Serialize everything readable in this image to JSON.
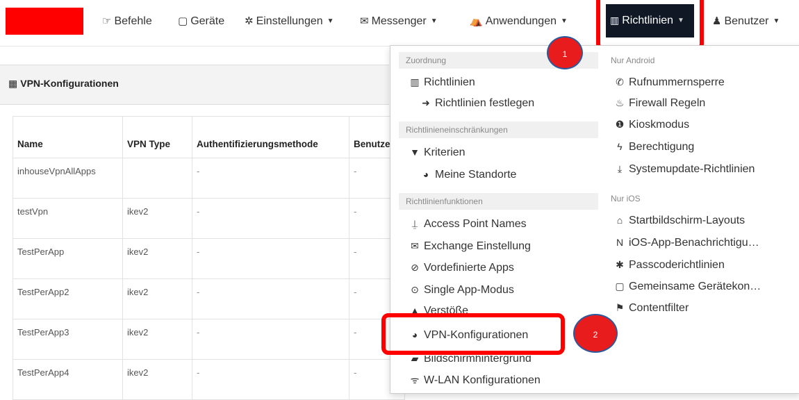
{
  "nav": {
    "items": [
      {
        "id": "befehle",
        "label": "Befehle",
        "icon": "hand-point-icon",
        "glyph": "☞",
        "caret": false
      },
      {
        "id": "geraete",
        "label": "Geräte",
        "icon": "mobile-icon",
        "glyph": "▢",
        "caret": false
      },
      {
        "id": "einstellungen",
        "label": "Einstellungen",
        "icon": "gear-icon",
        "glyph": "✲",
        "caret": true
      },
      {
        "id": "messenger",
        "label": "Messenger",
        "icon": "envelope-icon",
        "glyph": "✉",
        "caret": true
      },
      {
        "id": "anwendungen",
        "label": "Anwendungen",
        "icon": "app-stamp-icon",
        "glyph": "⛺",
        "caret": true
      }
    ],
    "active": {
      "label": "Richtlinien",
      "icon": "columns-icon",
      "glyph": "▥"
    },
    "user": {
      "label": "Benutzer",
      "icon": "user-icon",
      "glyph": "♟"
    }
  },
  "panel": {
    "title": "VPN-Konfigurationen",
    "icon": "th-grid-icon",
    "glyph": "▦"
  },
  "table": {
    "columns": [
      "Name",
      "VPN Type",
      "Authentifizierungsmethode",
      "Benutze"
    ],
    "rows": [
      [
        "inhouseVpnAllApps",
        "",
        "-",
        "-"
      ],
      [
        "testVpn",
        "ikev2",
        "-",
        "-"
      ],
      [
        "TestPerApp",
        "ikev2",
        "-",
        "-"
      ],
      [
        "TestPerApp2",
        "ikev2",
        "-",
        "-"
      ],
      [
        "TestPerApp3",
        "ikev2",
        "-",
        "-"
      ],
      [
        "TestPerApp4",
        "ikev2",
        "-",
        "-"
      ]
    ]
  },
  "menu": {
    "left": {
      "zuordnung_header": "Zuordnung",
      "richtlinien": {
        "label": "Richtlinien",
        "glyph": "▥"
      },
      "festlegen": {
        "label": "Richtlinien festlegen",
        "glyph": "➜"
      },
      "einschraenkungen_header": "Richtlinieneinschränkungen",
      "kriterien": {
        "label": "Kriterien",
        "glyph": "▼"
      },
      "standorte": {
        "label": "Meine Standorte",
        "glyph": "◕"
      },
      "funktionen_header": "Richtlinienfunktionen",
      "apn": {
        "label": "Access Point Names",
        "glyph": "⍊"
      },
      "exchange": {
        "label": "Exchange Einstellung",
        "glyph": "✉"
      },
      "vordefinierte": {
        "label": "Vordefinierte Apps",
        "glyph": "⊘"
      },
      "single": {
        "label": "Single App-Modus",
        "glyph": "⊙"
      },
      "verstoesse": {
        "label": "Verstöße",
        "glyph": "▲"
      },
      "vpn": {
        "label": "VPN-Konfigurationen",
        "glyph": "◕"
      },
      "hintergrund": {
        "label": "Bildschirmhintergrund",
        "glyph": "▰"
      },
      "wlan": {
        "label": "W-LAN Konfigurationen",
        "glyph": "ᯤ"
      }
    },
    "right": {
      "android_header": "Nur Android",
      "rufnummer": {
        "label": "Rufnummernsperre",
        "glyph": "✆"
      },
      "firewall": {
        "label": "Firewall Regeln",
        "glyph": "♨"
      },
      "kiosk": {
        "label": "Kioskmodus",
        "glyph": "❶"
      },
      "berechtigung": {
        "label": "Berechtigung",
        "glyph": "ϟ"
      },
      "systemupdate": {
        "label": "Systemupdate-Richtlinien",
        "glyph": "⤓"
      },
      "ios_header": "Nur iOS",
      "startbildschirm": {
        "label": "Startbildschirm-Layouts",
        "glyph": "⌂"
      },
      "ios_benachrichtigung": {
        "label": "iOS-App-Benachrichtigu…",
        "glyph": "N"
      },
      "passcode": {
        "label": "Passcoderichtlinien",
        "glyph": "✱"
      },
      "geraetekon": {
        "label": "Gemeinsame Gerätekon…",
        "glyph": "▢"
      },
      "contentfilter": {
        "label": "Contentfilter",
        "glyph": "⚑"
      }
    }
  },
  "annotations": {
    "step1": "1",
    "step2": "2"
  },
  "colors": {
    "highlight": "#ff0000",
    "active_nav": "#101826",
    "badge": "#e81c1c"
  }
}
